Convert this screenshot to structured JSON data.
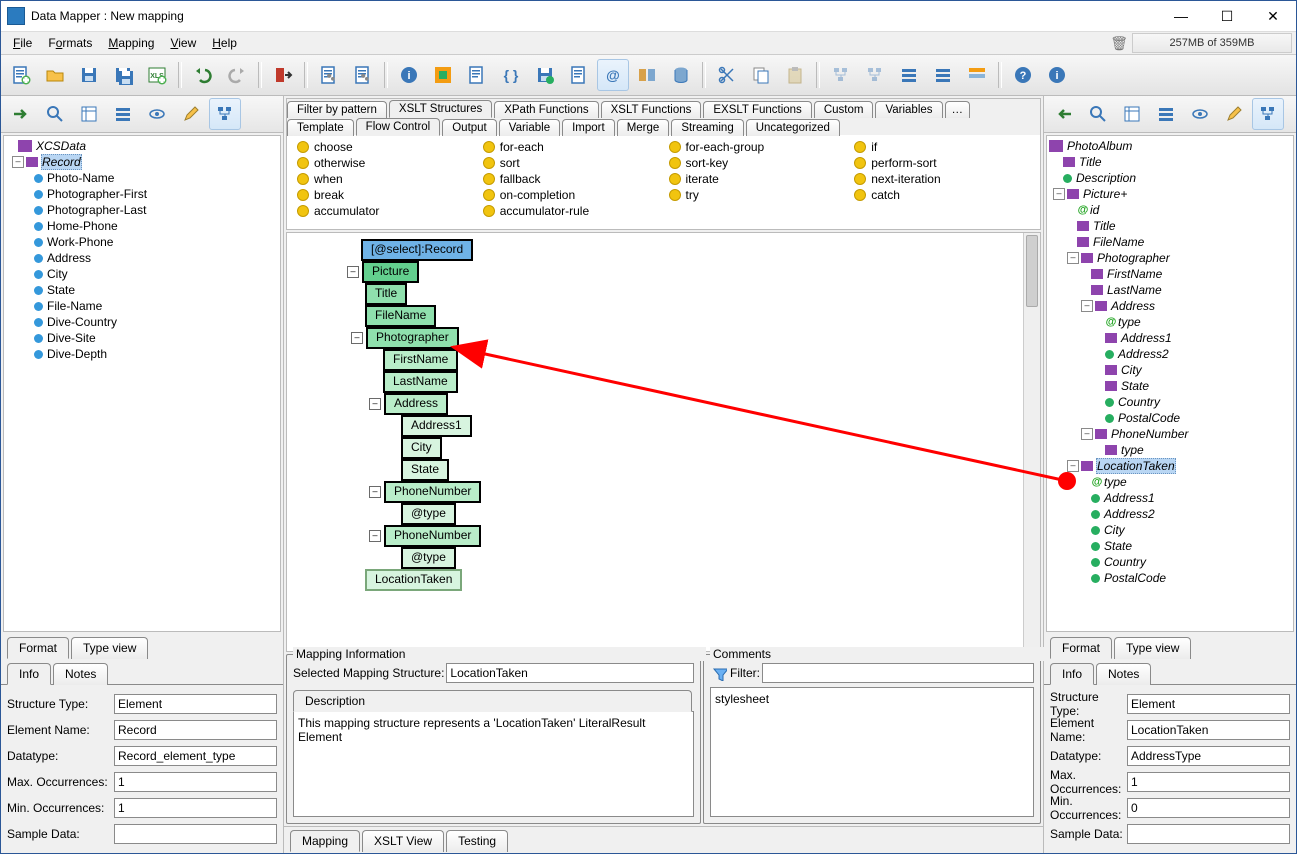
{
  "window": {
    "title": "Data Mapper : New mapping"
  },
  "menu": {
    "file": "File",
    "formats": "Formats",
    "mapping": "Mapping",
    "view": "View",
    "help": "Help"
  },
  "memory": "257MB of 359MB",
  "left": {
    "root": "XCSData",
    "record": "Record",
    "children": [
      "Photo-Name",
      "Photographer-First",
      "Photographer-Last",
      "Home-Phone",
      "Work-Phone",
      "Address",
      "City",
      "State",
      "File-Name",
      "Dive-Country",
      "Dive-Site",
      "Dive-Depth"
    ],
    "fmt_tab": "Format",
    "type_tab": "Type view",
    "info_tab": "Info",
    "notes_tab": "Notes",
    "props": {
      "stype_l": "Structure Type:",
      "stype_v": "Element",
      "ename_l": "Element Name:",
      "ename_v": "Record",
      "dtype_l": "Datatype:",
      "dtype_v": "Record_element_type",
      "max_l": "Max. Occurrences:",
      "max_v": "1",
      "min_l": "Min. Occurrences:",
      "min_v": "1",
      "sample_l": "Sample Data:",
      "sample_v": ""
    }
  },
  "mid": {
    "cat_tabs1": [
      "Filter by pattern",
      "XSLT Structures",
      "XPath Functions",
      "XSLT Functions",
      "EXSLT Functions",
      "Custom",
      "Variables"
    ],
    "cat_tabs1_active": 1,
    "cat_tabs2": [
      "Template",
      "Flow Control",
      "Output",
      "Variable",
      "Import",
      "Merge",
      "Streaming",
      "Uncategorized"
    ],
    "cat_tabs2_active": 1,
    "funcs": [
      [
        "choose",
        "for-each",
        "for-each-group",
        "if"
      ],
      [
        "otherwise",
        "sort",
        "sort-key",
        "perform-sort"
      ],
      [
        "when",
        "fallback",
        "iterate",
        "next-iteration"
      ],
      [
        "break",
        "on-completion",
        "try",
        "catch"
      ],
      [
        "accumulator",
        "accumulator-rule",
        "",
        ""
      ]
    ],
    "map": {
      "n0": "[@select]:Record",
      "n1": "Picture",
      "n2": "Title",
      "n3": "FileName",
      "n4": "Photographer",
      "n5": "FirstName",
      "n6": "LastName",
      "n7": "Address",
      "n8": "Address1",
      "n9": "City",
      "n10": "State",
      "n11": "PhoneNumber",
      "n12": "@type",
      "n13": "PhoneNumber",
      "n14": "@type",
      "n15": "LocationTaken"
    },
    "info": {
      "title": "Mapping Information",
      "sel_l": "Selected Mapping Structure:",
      "sel_v": "LocationTaken",
      "desc_tab": "Description",
      "desc": "This mapping structure represents a 'LocationTaken' LiteralResult Element"
    },
    "comments": {
      "title": "Comments",
      "filter_l": "Filter:",
      "body": "stylesheet"
    },
    "bot_tabs": [
      "Mapping",
      "XSLT View",
      "Testing"
    ]
  },
  "right": {
    "root": "PhotoAlbum",
    "n_title": "Title",
    "n_desc": "Description",
    "n_pic": "Picture+",
    "n_id": "id",
    "n_ptitle": "Title",
    "n_fname": "FileName",
    "n_photog": "Photographer",
    "n_first": "FirstName",
    "n_last": "LastName",
    "n_addr": "Address",
    "n_atype": "type",
    "n_a1": "Address1",
    "n_a2": "Address2",
    "n_city": "City",
    "n_state": "State",
    "n_country": "Country",
    "n_postal": "PostalCode",
    "n_phone": "PhoneNumber",
    "n_ptype": "type",
    "n_loc": "LocationTaken",
    "n_ltype": "type",
    "n_la1": "Address1",
    "n_la2": "Address2",
    "n_lcity": "City",
    "n_lstate": "State",
    "n_lcountry": "Country",
    "n_lpostal": "PostalCode",
    "fmt_tab": "Format",
    "type_tab": "Type view",
    "info_tab": "Info",
    "notes_tab": "Notes",
    "props": {
      "stype_l": "Structure Type:",
      "stype_v": "Element",
      "ename_l": "Element Name:",
      "ename_v": "LocationTaken",
      "dtype_l": "Datatype:",
      "dtype_v": "AddressType",
      "max_l": "Max. Occurrences:",
      "max_v": "1",
      "min_l": "Min. Occurrences:",
      "min_v": "0",
      "sample_l": "Sample Data:",
      "sample_v": ""
    }
  }
}
